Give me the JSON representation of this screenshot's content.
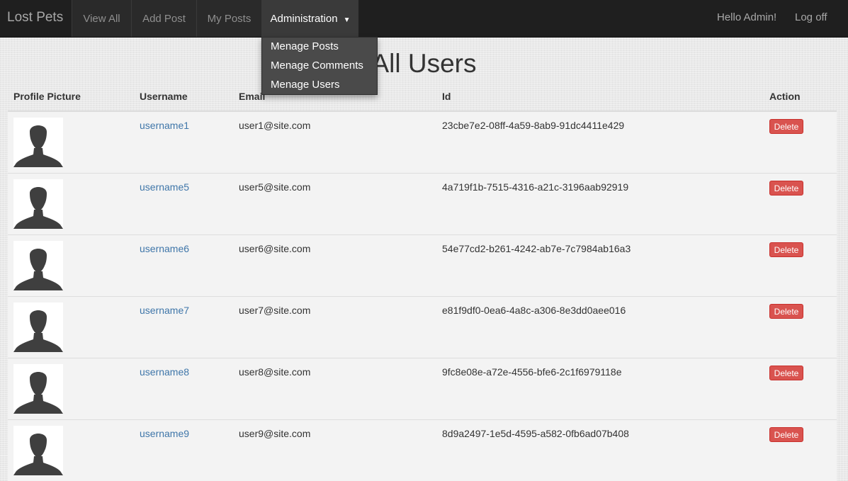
{
  "navbar": {
    "brand": "Lost Pets",
    "items": [
      {
        "label": "View All"
      },
      {
        "label": "Add Post"
      },
      {
        "label": "My Posts"
      },
      {
        "label": "Administration"
      }
    ],
    "greeting": "Hello Admin!",
    "logoff": "Log off"
  },
  "dropdown": {
    "items": [
      "Menage Posts",
      "Menage Comments",
      "Menage Users"
    ]
  },
  "page": {
    "title": "All Users"
  },
  "table": {
    "headers": [
      "Profile Picture",
      "Username",
      "Email",
      "Id",
      "Action"
    ],
    "rows": [
      {
        "username": "username1",
        "email": "user1@site.com",
        "id": "23cbe7e2-08ff-4a59-8ab9-91dc4411e429",
        "action": "Delete"
      },
      {
        "username": "username5",
        "email": "user5@site.com",
        "id": "4a719f1b-7515-4316-a21c-3196aab92919",
        "action": "Delete"
      },
      {
        "username": "username6",
        "email": "user6@site.com",
        "id": "54e77cd2-b261-4242-ab7e-7c7984ab16a3",
        "action": "Delete"
      },
      {
        "username": "username7",
        "email": "user7@site.com",
        "id": "e81f9df0-0ea6-4a8c-a306-8e3dd0aee016",
        "action": "Delete"
      },
      {
        "username": "username8",
        "email": "user8@site.com",
        "id": "9fc8e08e-a72e-4556-bfe6-2c1f6979118e",
        "action": "Delete"
      },
      {
        "username": "username9",
        "email": "user9@site.com",
        "id": "8d9a2497-1e5d-4595-a582-0fb6ad07b408",
        "action": "Delete"
      }
    ]
  },
  "colors": {
    "navbar": "#1f1f1f",
    "link": "#3f76a9",
    "danger": "#d9534f"
  },
  "icons": {
    "profile_picture": "user-silhouette-icon",
    "dropdown_caret": "caret-down-icon"
  }
}
